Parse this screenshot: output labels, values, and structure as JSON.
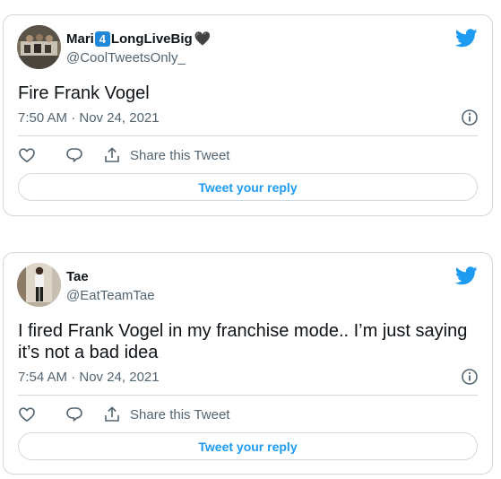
{
  "tweets": [
    {
      "display_name_prefix": "Mari",
      "display_name_badge": "4",
      "display_name_suffix": "LongLiveBig",
      "display_name_emoji": "🖤",
      "handle": "@CoolTweetsOnly_",
      "text": "Fire Frank Vogel",
      "timestamp": "7:50 AM · Nov 24, 2021",
      "share_label": "Share this Tweet",
      "reply_label": "Tweet your reply"
    },
    {
      "display_name": "Tae",
      "handle": "@EatTeamTae",
      "text": "I fired Frank Vogel in my franchise mode.. I’m just saying it’s not a bad idea",
      "timestamp": "7:54 AM · Nov 24, 2021",
      "share_label": "Share this Tweet",
      "reply_label": "Tweet your reply"
    }
  ],
  "icons": {
    "brand": "twitter-bird-icon",
    "info": "info-icon",
    "like": "heart-icon",
    "reply": "comment-bubble-icon",
    "share": "share-upload-icon"
  },
  "colors": {
    "twitter_blue": "#1d9bf0",
    "secondary_text": "#536471",
    "border": "#cfd9de"
  }
}
